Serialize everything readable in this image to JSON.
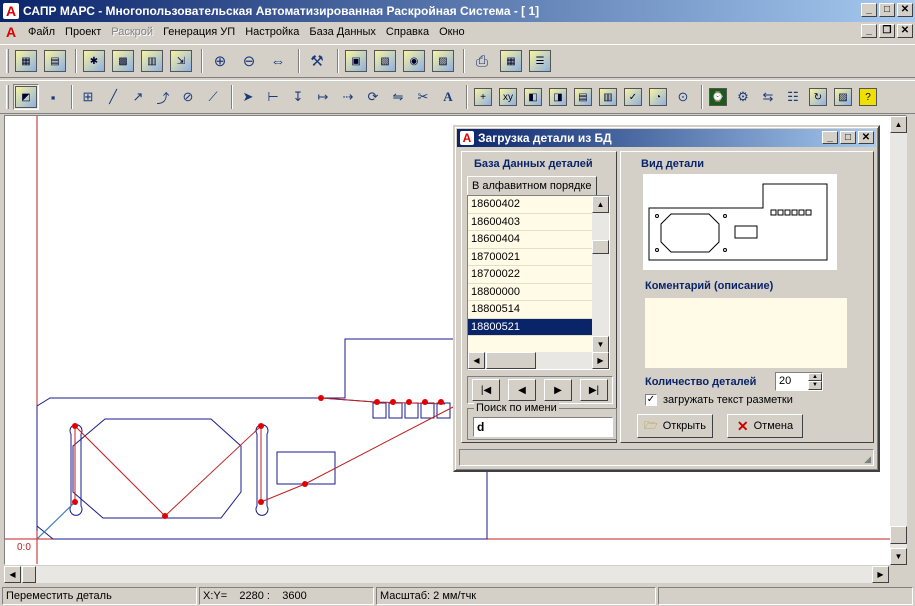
{
  "window": {
    "title": "САПР МАРС - Многопользовательская Автоматизированная Раскройная Система - [ 1]"
  },
  "menu": [
    {
      "label": "Файл",
      "enabled": true
    },
    {
      "label": "Проект",
      "enabled": true
    },
    {
      "label": "Раскрой",
      "enabled": false
    },
    {
      "label": "Генерация УП",
      "enabled": true
    },
    {
      "label": "Настройка",
      "enabled": true
    },
    {
      "label": "База Данных",
      "enabled": true
    },
    {
      "label": "Справка",
      "enabled": true
    },
    {
      "label": "Окно",
      "enabled": true
    }
  ],
  "canvas": {
    "origin_label": "0:0"
  },
  "dialog": {
    "title": "Загрузка детали из БД",
    "db_group_label": "База Данных деталей",
    "tab_label": "В алфавитном порядке",
    "items": [
      "18600402",
      "18600403",
      "18600404",
      "18700021",
      "18700022",
      "18800000",
      "18800514",
      "18800521"
    ],
    "selected_index": 7,
    "search_label": "Поиск по имени",
    "search_value": "d",
    "preview_label": "Вид детали",
    "comment_label": "Коментарий (описание)",
    "quantity_label": "Количество деталей",
    "quantity_value": "20",
    "load_text_label": "загружать текст разметки",
    "load_text_checked": true,
    "open_button": "Открыть",
    "cancel_button": "Отмена"
  },
  "status": {
    "hint": "Переместить деталь",
    "coords_label": "X:Y=",
    "x": "2280 :",
    "y": "3600",
    "scale": "Масштаб: 2 мм/тчк"
  },
  "colors": {
    "titlebar": "#0a246a",
    "selection": "#0a246a",
    "part_outline": "#1a1a8c",
    "cut_path": "#c02020",
    "axis": "#c02020"
  }
}
